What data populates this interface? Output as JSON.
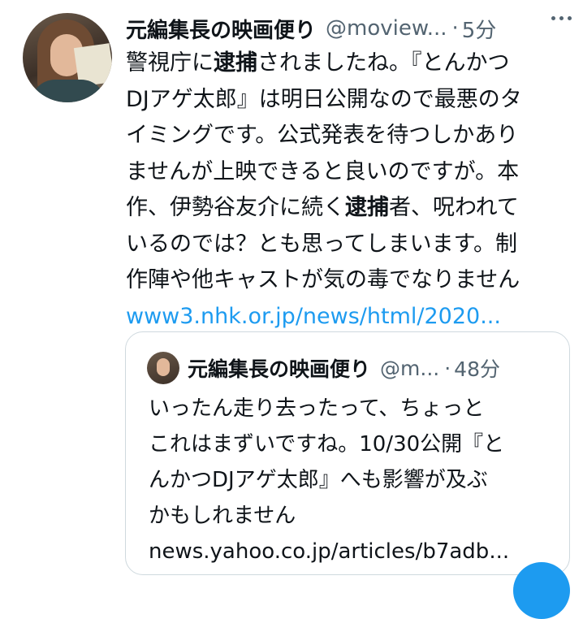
{
  "tweet": {
    "display_name": "元編集長の映画便り",
    "handle": "@moview...",
    "separator": "·",
    "time": "5分",
    "lines": [
      {
        "a": "警視庁に",
        "b": "逮捕",
        "c": "されましたね。『とんかつ"
      },
      {
        "a": "DJアゲ太郎』は明日公開なので最悪のタ",
        "b": "",
        "c": ""
      },
      {
        "a": "イミングです。公式発表を待つしかあり",
        "b": "",
        "c": ""
      },
      {
        "a": "ませんが上映できると良いのですが。本",
        "b": "",
        "c": ""
      },
      {
        "a": "作、伊勢谷友介に続く",
        "b": "逮捕",
        "c": "者、呪われて"
      },
      {
        "a": "いるのでは？とも思ってしまいます。制",
        "b": "",
        "c": ""
      },
      {
        "a": "作陣や他キャストが気の毒でなりません",
        "b": "",
        "c": ""
      }
    ],
    "link": "www3.nhk.or.jp/news/html/2020..."
  },
  "quote": {
    "display_name": "元編集長の映画便り",
    "handle": "@m...",
    "separator": "·",
    "time": "48分",
    "lines": [
      "いったん走り去ったって、ちょっと",
      "これはまずいですね。10/30公開『と",
      "んかつDJアゲ太郎』へも影響が及ぶ",
      "かもしれません",
      "news.yahoo.co.jp/articles/b7adb..."
    ]
  },
  "colors": {
    "accent": "#1d9bf0",
    "text": "#0f1419",
    "muted": "#536471",
    "border": "#cfd9de"
  },
  "icons": {
    "more": "more-horizontal-icon",
    "compose": "compose-fab-icon"
  }
}
